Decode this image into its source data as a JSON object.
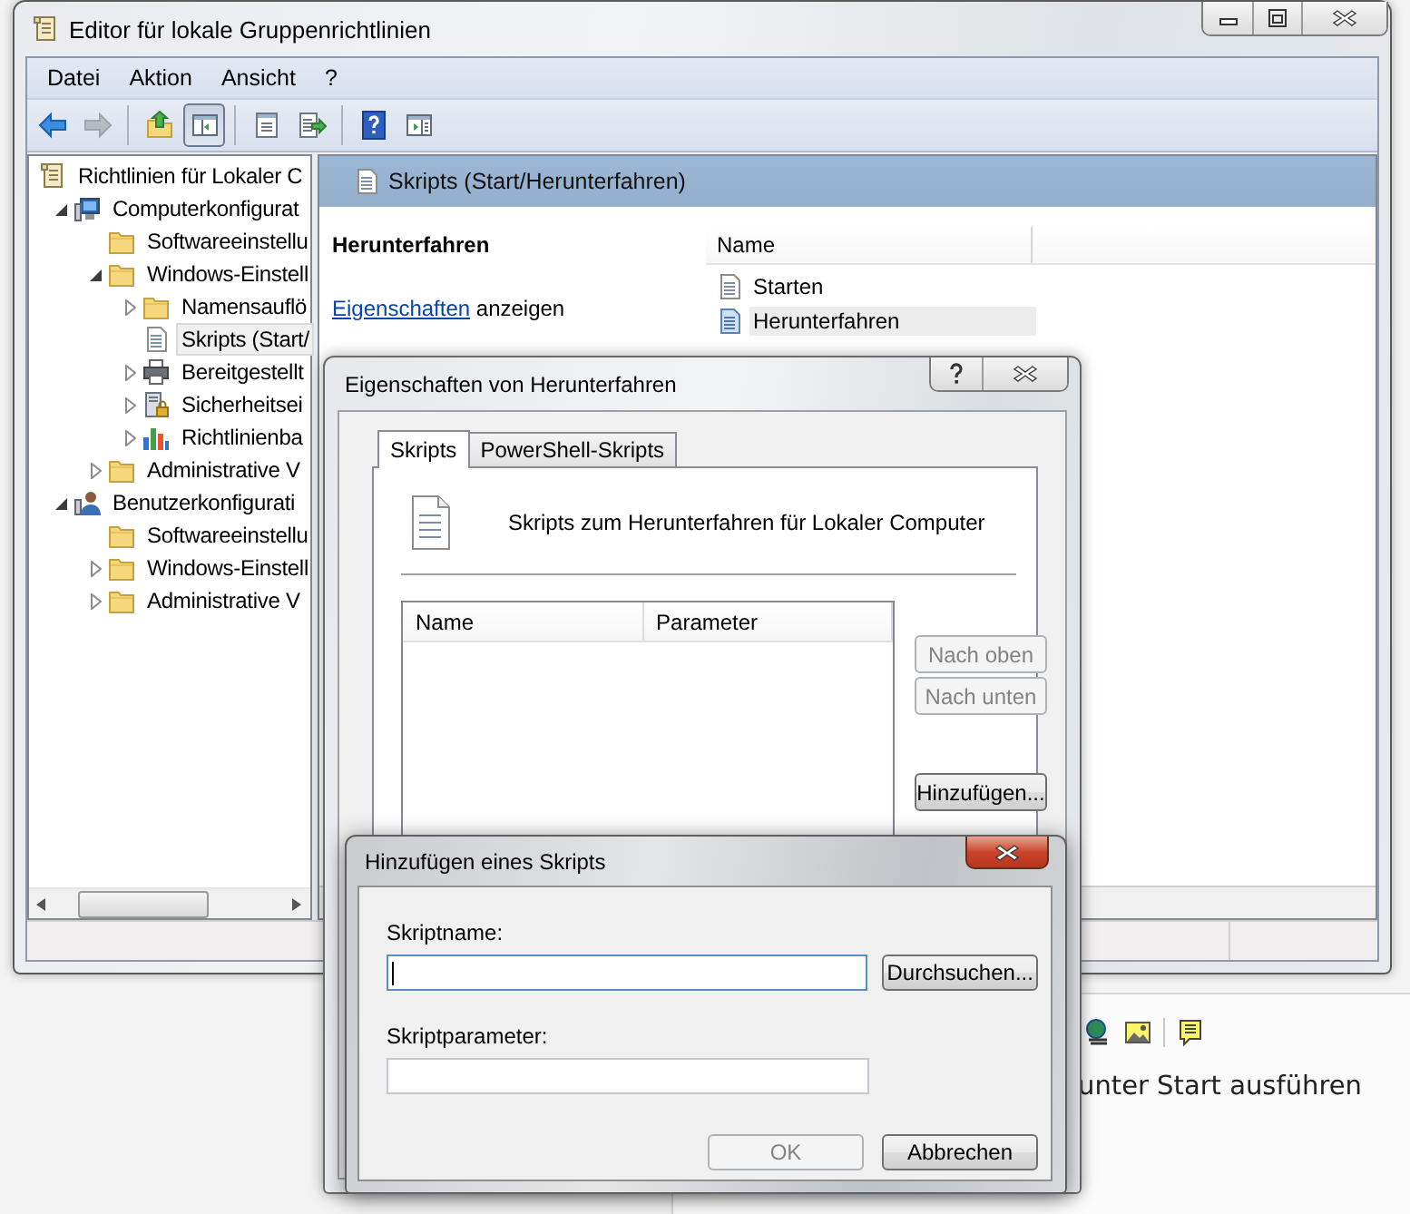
{
  "main_window": {
    "title": "Editor für lokale Gruppenrichtlinien",
    "menu": [
      "Datei",
      "Aktion",
      "Ansicht",
      "?"
    ],
    "toolbar": [
      [
        {
          "kind": "back",
          "pressed": false,
          "disabled": false
        },
        {
          "kind": "forward",
          "pressed": false,
          "disabled": true
        }
      ],
      [
        {
          "kind": "up",
          "pressed": false,
          "disabled": false
        },
        {
          "kind": "tree",
          "pressed": true,
          "disabled": false
        }
      ],
      [
        {
          "kind": "properties",
          "pressed": false,
          "disabled": false
        },
        {
          "kind": "export",
          "pressed": false,
          "disabled": false
        }
      ],
      [
        {
          "kind": "help",
          "pressed": false,
          "disabled": false
        },
        {
          "kind": "action_pane",
          "pressed": false,
          "disabled": false
        }
      ]
    ],
    "tree": [
      {
        "label": "Richtlinien für Lokaler C",
        "kind": "policy",
        "selected": false,
        "children": [
          {
            "label": "Computerkonfigurat",
            "kind": "computer",
            "expanded": true,
            "selected": false,
            "children": [
              {
                "label": "Softwareeinstellu",
                "kind": "folder",
                "selected": false
              },
              {
                "label": "Windows-Einstell",
                "kind": "folder",
                "expanded": true,
                "selected": false,
                "children": [
                  {
                    "label": "Namensauflö",
                    "kind": "folder",
                    "expanded": false,
                    "selected": false
                  },
                  {
                    "label": "Skripts (Start/",
                    "kind": "script",
                    "selected": true
                  },
                  {
                    "label": "Bereitgestellt",
                    "kind": "printer",
                    "expanded": false,
                    "selected": false
                  },
                  {
                    "label": "Sicherheitsei",
                    "kind": "security",
                    "expanded": false,
                    "selected": false
                  },
                  {
                    "label": "Richtlinienba",
                    "kind": "chart",
                    "expanded": false,
                    "selected": false
                  }
                ]
              },
              {
                "label": "Administrative V",
                "kind": "folder",
                "expanded": false,
                "selected": false
              }
            ]
          },
          {
            "label": "Benutzerkonfigurati",
            "kind": "user",
            "expanded": true,
            "selected": false,
            "children": [
              {
                "label": "Softwareeinstellu",
                "kind": "folder",
                "selected": false
              },
              {
                "label": "Windows-Einstell",
                "kind": "folder",
                "expanded": false,
                "selected": false
              },
              {
                "label": "Administrative V",
                "kind": "folder",
                "expanded": false,
                "selected": false
              }
            ]
          }
        ]
      }
    ],
    "details": {
      "header": "Skripts (Start/Herunterfahren)",
      "heading": "Herunterfahren",
      "link": "Eigenschaften",
      "link_text": "anzeigen",
      "columns": [
        "Name"
      ],
      "items": [
        {
          "label": "Starten",
          "selected": false
        },
        {
          "label": "Herunterfahren",
          "selected": true
        }
      ]
    }
  },
  "properties_dialog": {
    "title": "Eigenschaften von Herunterfahren",
    "tabs": [
      {
        "label": "Skripts",
        "selected": true
      },
      {
        "label": "PowerShell-Skripts",
        "selected": false
      }
    ],
    "description": "Skripts zum Herunterfahren für Lokaler Computer",
    "columns": [
      "Name",
      "Parameter"
    ],
    "move_buttons": [
      {
        "label": "Nach oben",
        "disabled": true
      },
      {
        "label": "Nach unten",
        "disabled": true
      }
    ],
    "add_button": {
      "label": "Hinzufügen...",
      "disabled": false
    }
  },
  "add_script_dialog": {
    "title": "Hinzufügen eines Skripts",
    "fields": [
      {
        "label": "Skriptname:",
        "focused": true
      },
      {
        "label": "Skriptparameter:",
        "focused": false
      }
    ],
    "browse_button": "Durchsuchen...",
    "buttons": [
      {
        "label": "OK",
        "disabled": true
      },
      {
        "label": "Abbrechen",
        "disabled": false
      }
    ]
  },
  "background": {
    "text": "unter Start ausführen"
  }
}
